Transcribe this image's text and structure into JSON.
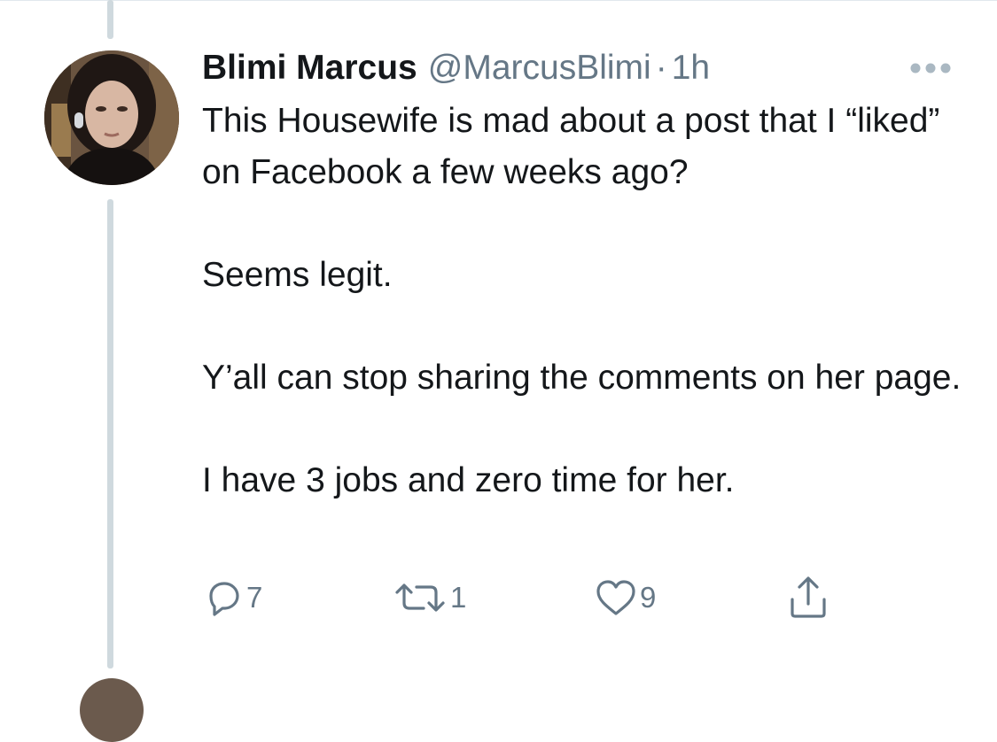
{
  "tweet": {
    "author_name": "Blimi Marcus",
    "handle": "@MarcusBlimi",
    "separator": "·",
    "time_ago": "1h",
    "paragraphs": [
      "This Housewife is mad about a post that I “liked” on Facebook a few weeks ago?",
      "Seems legit.",
      "Y’all can stop sharing the comments on her page.",
      "I have 3 jobs and zero time for her."
    ]
  },
  "actions": {
    "reply": {
      "icon": "reply-icon",
      "count": "7"
    },
    "retweet": {
      "icon": "retweet-icon",
      "count": "1"
    },
    "like": {
      "icon": "heart-icon",
      "count": "9"
    },
    "share": {
      "icon": "share-icon"
    }
  },
  "colors": {
    "text_primary": "#14171a",
    "text_secondary": "#657786",
    "thread_line": "#cfd9de",
    "divider": "#e1e8ed"
  }
}
